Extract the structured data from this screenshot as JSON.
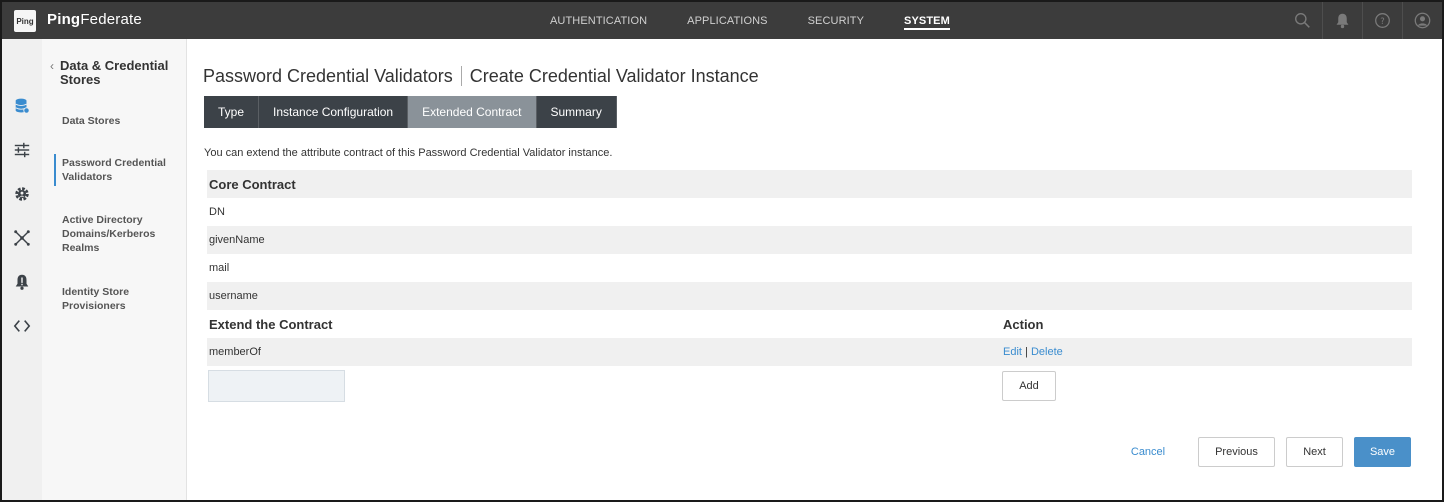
{
  "app": {
    "logo_text": "Ping",
    "brand_bold": "Ping",
    "brand_light": "Federate"
  },
  "topnav": [
    "AUTHENTICATION",
    "APPLICATIONS",
    "SECURITY",
    "SYSTEM"
  ],
  "topnav_active": "SYSTEM",
  "top_icons": [
    "search-icon",
    "bell-icon",
    "help-icon",
    "user-icon"
  ],
  "rail_icons": [
    "database-icon",
    "sliders-icon",
    "gear-icon",
    "network-icon",
    "alert-icon",
    "code-icon"
  ],
  "subnav": {
    "back_title": "Data & Credential Stores",
    "items": [
      {
        "label": "Data Stores"
      },
      {
        "label": "Password Credential Validators"
      },
      {
        "label": "Active Directory Domains/Kerberos Realms"
      },
      {
        "label": "Identity Store Provisioners"
      }
    ]
  },
  "main": {
    "title_part1": "Password Credential Validators",
    "title_part2": "Create Credential Validator Instance",
    "tabs": [
      {
        "label": "Type"
      },
      {
        "label": "Instance Configuration"
      },
      {
        "label": "Extended Contract"
      },
      {
        "label": "Summary"
      }
    ],
    "active_tab": "Extended Contract",
    "intro": "You can extend the attribute contract of this Password Credential Validator instance.",
    "core_contract": {
      "header": "Core Contract",
      "rows": [
        "DN",
        "givenName",
        "mail",
        "username"
      ]
    },
    "extend": {
      "header": "Extend the Contract",
      "action_header": "Action",
      "rows": [
        {
          "name": "memberOf",
          "edit": "Edit",
          "sep": "|",
          "delete": "Delete"
        }
      ],
      "new_value": "",
      "add_label": "Add"
    },
    "footer": {
      "cancel": "Cancel",
      "previous": "Previous",
      "next": "Next",
      "save": "Save"
    }
  },
  "colors": {
    "topbar": "#3c3c3c",
    "tab_dark": "#3c4248",
    "tab_active": "#8a9299",
    "link": "#3a8ccf",
    "save": "#4a90c9"
  }
}
